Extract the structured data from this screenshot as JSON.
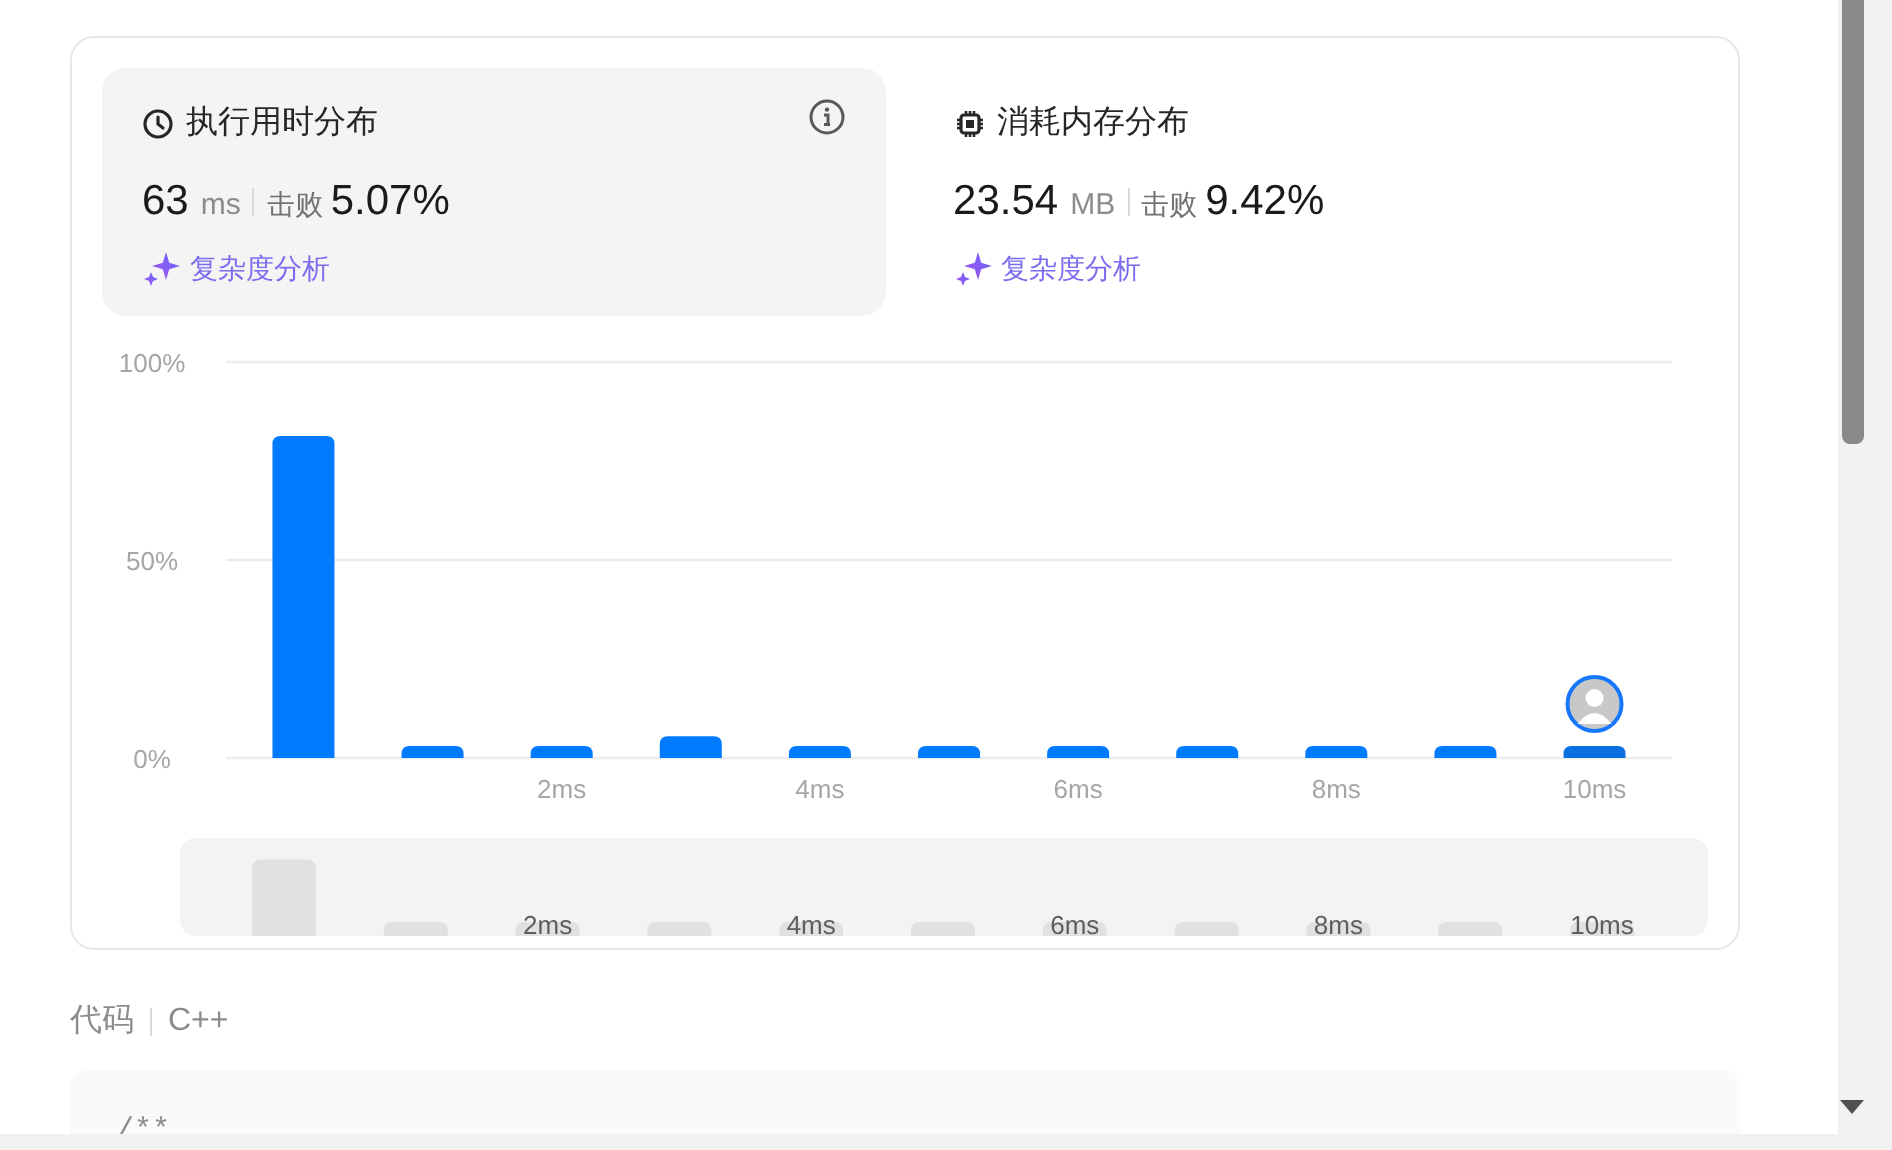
{
  "panels": [
    {
      "kind": "runtime",
      "title": "执行用时分布",
      "selected": true,
      "value": "63",
      "unit": "ms",
      "beats_label": "击败",
      "beats": "5.07%",
      "link": "复杂度分析",
      "info": true
    },
    {
      "kind": "memory",
      "title": "消耗内存分布",
      "selected": false,
      "value": "23.54",
      "unit": "MB",
      "beats_label": "击败",
      "beats": "9.42%",
      "link": "复杂度分析",
      "info": false
    }
  ],
  "chart_data": {
    "type": "bar",
    "x": [
      0,
      1,
      2,
      3,
      4,
      5,
      6,
      7,
      8,
      9,
      10
    ],
    "values": [
      81.3,
      3,
      3,
      5.5,
      3,
      3,
      3,
      3,
      3,
      3,
      3
    ],
    "ylim": [
      0,
      100
    ],
    "yticks": [
      {
        "value": 0,
        "label": "0%"
      },
      {
        "value": 50,
        "label": "50%"
      },
      {
        "value": 100,
        "label": "100%"
      }
    ],
    "xticks": [
      {
        "value": 2,
        "label": "2ms"
      },
      {
        "value": 4,
        "label": "4ms"
      },
      {
        "value": 6,
        "label": "6ms"
      },
      {
        "value": 8,
        "label": "8ms"
      },
      {
        "value": 10,
        "label": "10ms"
      }
    ],
    "xlim": [
      -0.6,
      10.6
    ]
  },
  "bar_states": [
    {
      "selected": false
    },
    {
      "selected": false
    },
    {
      "selected": false
    },
    {
      "selected": false
    },
    {
      "selected": false
    },
    {
      "selected": false
    },
    {
      "selected": false
    },
    {
      "selected": false
    },
    {
      "selected": false
    },
    {
      "selected": false
    },
    {
      "selected": true
    }
  ],
  "navigator": {
    "labels": [
      "2ms",
      "4ms",
      "6ms",
      "8ms",
      "10ms"
    ]
  },
  "code": {
    "label": "代码",
    "language": "C++",
    "first_line": "/**"
  }
}
